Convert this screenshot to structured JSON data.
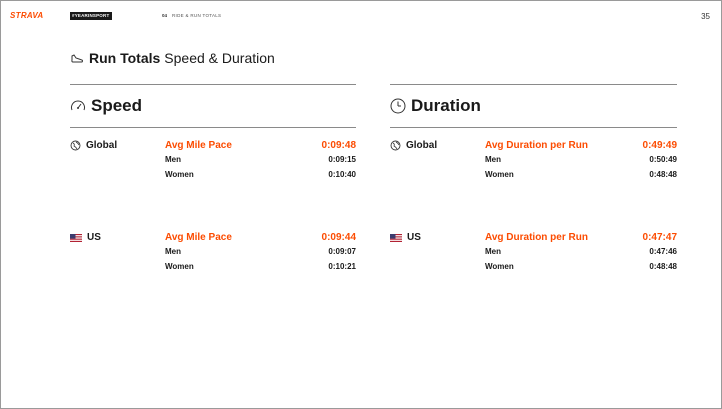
{
  "header": {
    "logo": "STRAVA",
    "tag": "#YEARINSPORT",
    "section_number": "04",
    "section_name": "RIDE & RUN TOTALS",
    "page_number": "35"
  },
  "title": {
    "bold": "Run Totals",
    "light": "Speed & Duration",
    "icon": "shoe-icon"
  },
  "speed": {
    "title": "Speed",
    "icon": "speedometer-icon",
    "blocks": [
      {
        "region": "Global",
        "region_icon": "globe-icon",
        "metric": "Avg Mile Pace",
        "value": "0:09:48",
        "rows": [
          {
            "label": "Men",
            "value": "0:09:15"
          },
          {
            "label": "Women",
            "value": "0:10:40"
          }
        ]
      },
      {
        "region": "US",
        "region_icon": "us-flag-icon",
        "metric": "Avg Mile Pace",
        "value": "0:09:44",
        "rows": [
          {
            "label": "Men",
            "value": "0:09:07"
          },
          {
            "label": "Women",
            "value": "0:10:21"
          }
        ]
      }
    ]
  },
  "duration": {
    "title": "Duration",
    "icon": "clock-icon",
    "blocks": [
      {
        "region": "Global",
        "region_icon": "globe-icon",
        "metric": "Avg Duration per Run",
        "value": "0:49:49",
        "rows": [
          {
            "label": "Men",
            "value": "0:50:49"
          },
          {
            "label": "Women",
            "value": "0:48:48"
          }
        ]
      },
      {
        "region": "US",
        "region_icon": "us-flag-icon",
        "metric": "Avg Duration per Run",
        "value": "0:47:47",
        "rows": [
          {
            "label": "Men",
            "value": "0:47:46"
          },
          {
            "label": "Women",
            "value": "0:48:48"
          }
        ]
      }
    ]
  },
  "colors": {
    "accent": "#fc4c02",
    "text": "#1a1a1a",
    "rule": "#8a8a8a"
  }
}
